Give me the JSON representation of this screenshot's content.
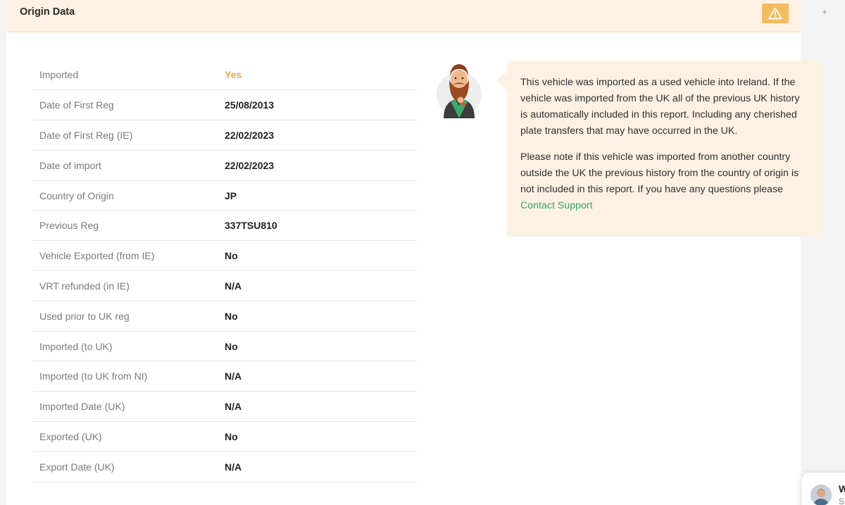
{
  "header": {
    "title": "Origin Data",
    "warning_icon": "warning-triangle-icon",
    "expand_label": "+"
  },
  "rows": [
    {
      "label": "Imported",
      "value": "Yes"
    },
    {
      "label": "Date of First Reg",
      "value": "25/08/2013"
    },
    {
      "label": "Date of First Reg (IE)",
      "value": "22/02/2023"
    },
    {
      "label": "Date of import",
      "value": "22/02/2023"
    },
    {
      "label": "Country of Origin",
      "value": "JP"
    },
    {
      "label": "Previous Reg",
      "value": "337TSU810"
    },
    {
      "label": "Vehicle Exported (from IE)",
      "value": "No"
    },
    {
      "label": "VRT refunded (in IE)",
      "value": "N/A"
    },
    {
      "label": "Used prior to UK reg",
      "value": "No"
    },
    {
      "label": "Imported (to UK)",
      "value": "No"
    },
    {
      "label": "Imported (to UK from NI)",
      "value": "N/A"
    },
    {
      "label": "Imported Date (UK)",
      "value": "N/A"
    },
    {
      "label": "Exported (UK)",
      "value": "No"
    },
    {
      "label": "Export Date (UK)",
      "value": "N/A"
    }
  ],
  "info": {
    "paragraph1": "This vehicle was imported as a used vehicle into Ireland. If the vehicle was imported from the UK all of the previous UK history is automatically included in this report. Including any cherished plate transfers that may have occurred in the UK.",
    "paragraph2": "Please note if this vehicle was imported from another country outside the UK the previous history from the country of origin is not included in this report. If you have any questions please",
    "link": "Contact Support"
  },
  "chat": {
    "initial": "W",
    "initial2": "S"
  },
  "colors": {
    "accent_orange": "#f2bd60",
    "yes_color": "#e9a94b",
    "link_green": "#37a36a",
    "panel_cream": "#fdf1e3"
  }
}
